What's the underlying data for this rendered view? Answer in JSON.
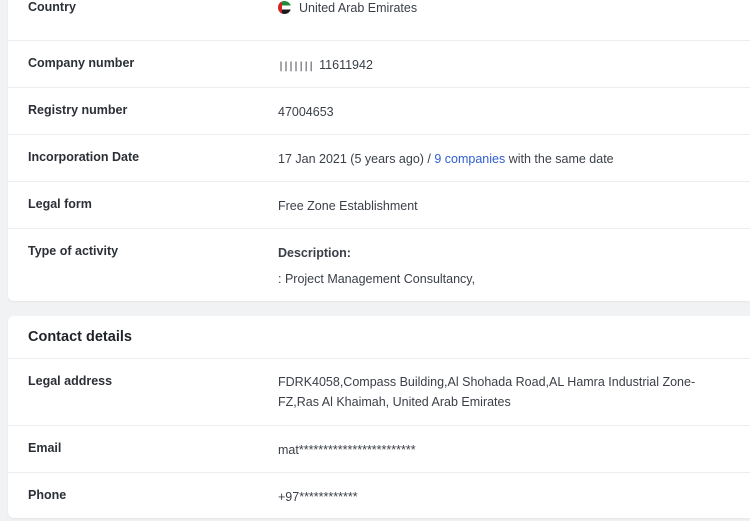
{
  "company": {
    "country_label": "Country",
    "country_value": "United Arab Emirates",
    "company_number_label": "Company number",
    "company_number_value": "11611942",
    "registry_number_label": "Registry number",
    "registry_number_value": "47004653",
    "incorporation_label": "Incorporation Date",
    "incorporation_date": "17 Jan 2021 (5 years ago) /",
    "incorporation_link": "9 companies",
    "incorporation_suffix": "with the same date",
    "legal_form_label": "Legal form",
    "legal_form_value": "Free Zone Establishment",
    "activity_label": "Type of activity",
    "activity_desc_heading": "Description:",
    "activity_desc_value": ": Project Management Consultancy,"
  },
  "contact": {
    "title": "Contact details",
    "legal_address_label": "Legal address",
    "legal_address_value": "FDRK4058,Compass Building,Al Shohada Road,AL Hamra Industrial Zone-FZ,Ras Al Khaimah, United Arab Emirates",
    "email_label": "Email",
    "email_value": "mat************************",
    "phone_label": "Phone",
    "phone_value": "+97************"
  },
  "icons": {
    "flag": "uae-flag-icon",
    "barcode": "barcode-icon"
  },
  "colors": {
    "link": "#2f5fd1",
    "background": "#f1f2f4",
    "card": "#ffffff"
  }
}
